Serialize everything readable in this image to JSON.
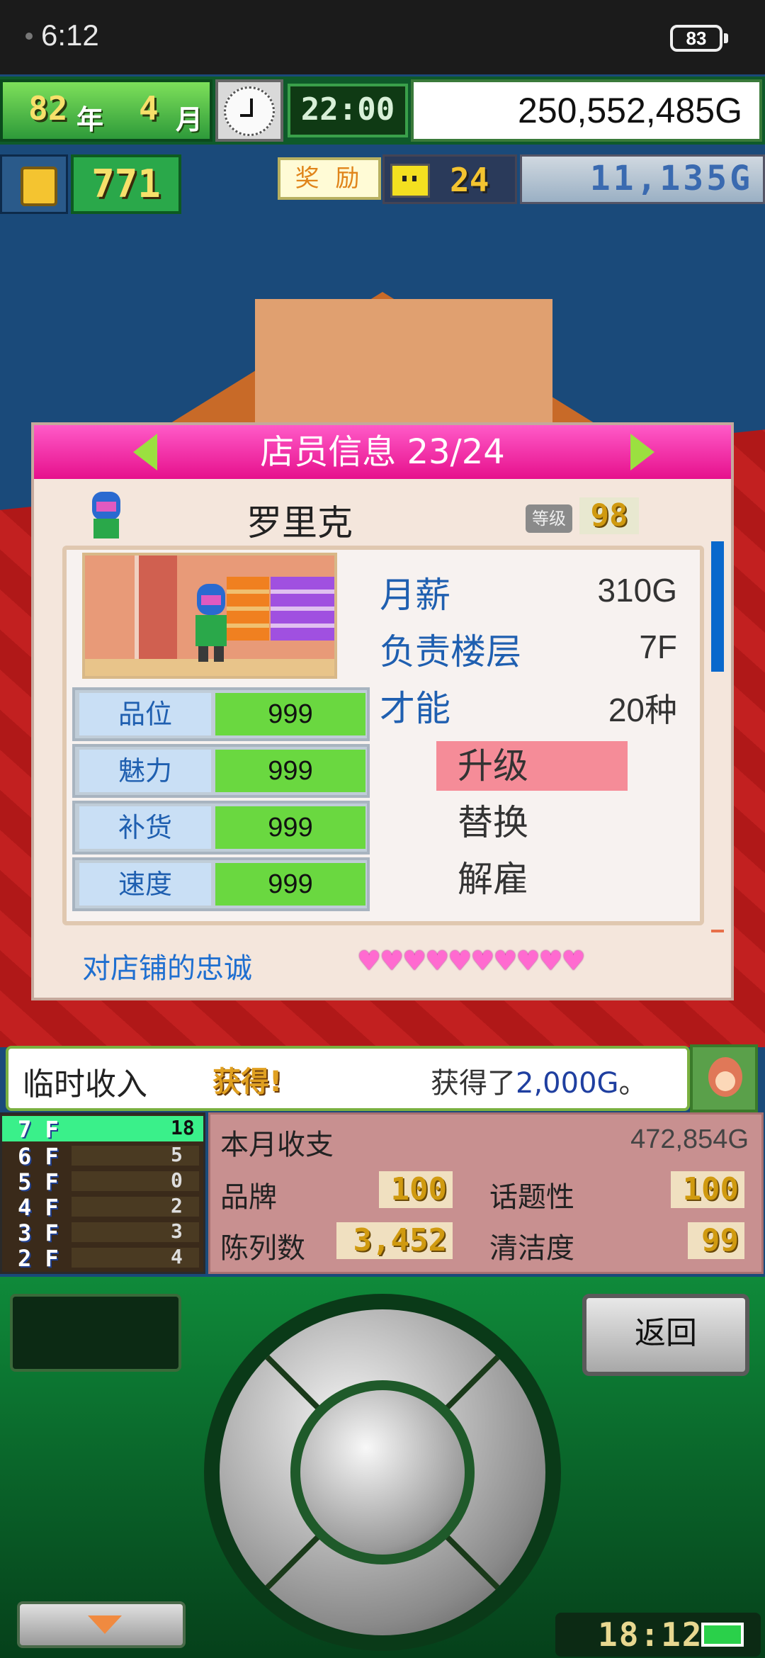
{
  "status_bar": {
    "time": "6:12",
    "battery": "83"
  },
  "hud": {
    "year_num": "82",
    "year_unit": "年",
    "month_num": "4",
    "month_unit": "月",
    "game_time": "22:00",
    "money": "250,552,485G",
    "points": "771",
    "reward_label": "奖 励",
    "visitors": "24",
    "research_money": "11,135G"
  },
  "dialog": {
    "title": "店员信息 23/24",
    "staff_name": "罗里克",
    "level_label": "等级",
    "level_value": "98",
    "stats": [
      {
        "label": "品位",
        "value": "999"
      },
      {
        "label": "魅力",
        "value": "999"
      },
      {
        "label": "补货",
        "value": "999"
      },
      {
        "label": "速度",
        "value": "999"
      }
    ],
    "info": [
      {
        "key": "月薪",
        "value": "310G"
      },
      {
        "key": "负责楼层",
        "value": "7F"
      },
      {
        "key": "才能",
        "value": "20种"
      }
    ],
    "actions": [
      "升级",
      "替换",
      "解雇"
    ],
    "loyalty_label": "对店铺的忠诚",
    "loyalty_hearts": "♥♥♥♥♥♥♥♥♥♥"
  },
  "notice": {
    "title": "临时收入",
    "gain": "获得!",
    "msg_prefix": "获得了",
    "msg_amount": "2,000G",
    "msg_suffix": "。"
  },
  "floors": [
    {
      "floor": "7 F",
      "count": "18",
      "active": true
    },
    {
      "floor": "6 F",
      "count": "5"
    },
    {
      "floor": "5 F",
      "count": "0"
    },
    {
      "floor": "4 F",
      "count": "2"
    },
    {
      "floor": "3 F",
      "count": "3"
    },
    {
      "floor": "2 F",
      "count": "4"
    }
  ],
  "finance": {
    "monthly_label": "本月收支",
    "monthly_value": "472,854G",
    "brand_label": "品牌",
    "brand_value": "100",
    "topic_label": "话题性",
    "topic_value": "100",
    "display_label": "陈列数",
    "display_value": "3,452",
    "clean_label": "清洁度",
    "clean_value": "99"
  },
  "controller": {
    "back_label": "返回",
    "clock": "18:12"
  },
  "colors": {
    "header_pink": "#e6108c",
    "stat_green": "#6ad840",
    "selected_action": "#f58c98",
    "accent_blue": "#1f5fb0"
  }
}
